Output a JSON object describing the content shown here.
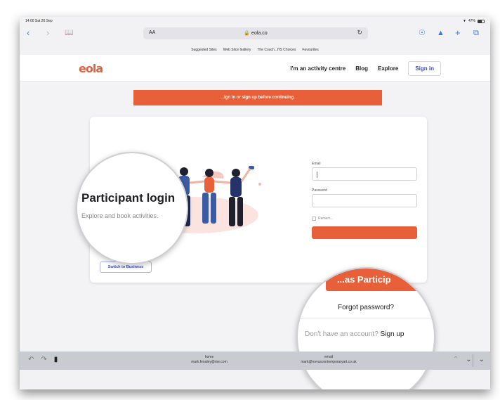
{
  "status": {
    "time": "14:00  Sat 26 Sep",
    "battery": "47%"
  },
  "browser": {
    "url_aa": "AA",
    "url": "eola.co",
    "favourites": [
      "Suggested Sites",
      "Web Slice Gallery",
      "The Couch...HS Choices",
      "Favourites"
    ]
  },
  "site": {
    "logo": "eola",
    "nav": {
      "activity_centre": "I'm an activity centre",
      "blog": "Blog",
      "explore": "Explore",
      "signin": "Sign in"
    }
  },
  "alert": "...ign in or sign up before continuing.",
  "login": {
    "title": "Participant login",
    "subtitle": "Explore and book activities.",
    "email_label": "Email",
    "password_label": "Password",
    "remember": "Remem...",
    "button": "...as Particip",
    "forgot": "Forgot password?",
    "no_account": "Don't have an account?",
    "signup": "Sign up",
    "switch": "Switch to Business"
  },
  "keyboard_bar": {
    "suggestion1": {
      "label": "home",
      "value": "mark.fenaley@me.com"
    },
    "suggestion2": {
      "label": "email",
      "value": "mark@novuscontemporaryart.co.uk"
    }
  },
  "icons": [
    "back-icon",
    "forward-icon",
    "bookmarks-icon",
    "reload-icon",
    "download-icon",
    "share-icon",
    "new-tab-icon",
    "tabs-icon",
    "undo-icon",
    "redo-icon",
    "paste-icon",
    "chevron-up-icon",
    "chevron-down-icon",
    "hide-keyboard-icon"
  ],
  "colors": {
    "accent": "#e8603a",
    "link": "#3a4cb0",
    "ios_blue": "#3478f6"
  }
}
